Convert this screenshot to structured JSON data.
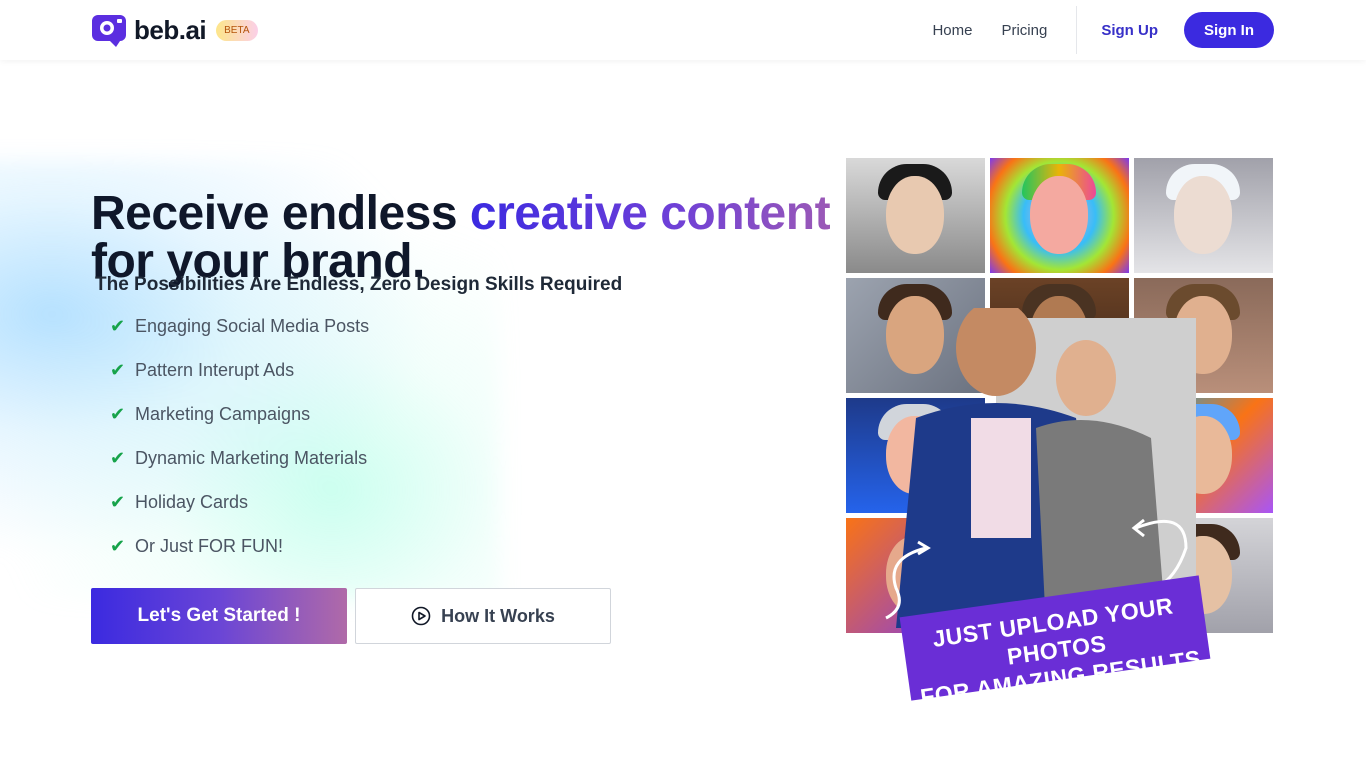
{
  "brand": {
    "name": "beb.ai",
    "badge": "BETA"
  },
  "nav": {
    "home": "Home",
    "pricing": "Pricing",
    "signup": "Sign Up",
    "signin": "Sign In"
  },
  "hero": {
    "headline_prefix": "Receive endless",
    "headline_accent": "creative content",
    "headline_suffix": "for your brand.",
    "subheadline": "The Possibilities Are Endless, Zero Design Skills Required",
    "features": [
      "Engaging Social Media Posts",
      "Pattern Interupt Ads",
      "Marketing Campaigns",
      "Dynamic Marketing Materials",
      "Holiday Cards",
      "Or Just FOR FUN!"
    ],
    "cta_primary": "Let's Get Started !",
    "cta_secondary": "How It Works"
  },
  "collage": {
    "banner_line1": "JUST UPLOAD YOUR PHOTOS",
    "banner_line2": "FOR AMAZING RESULTS"
  },
  "colors": {
    "primary": "#3b2ae0",
    "accent_purple": "#6a2ed6",
    "check_green": "#16a34a"
  }
}
